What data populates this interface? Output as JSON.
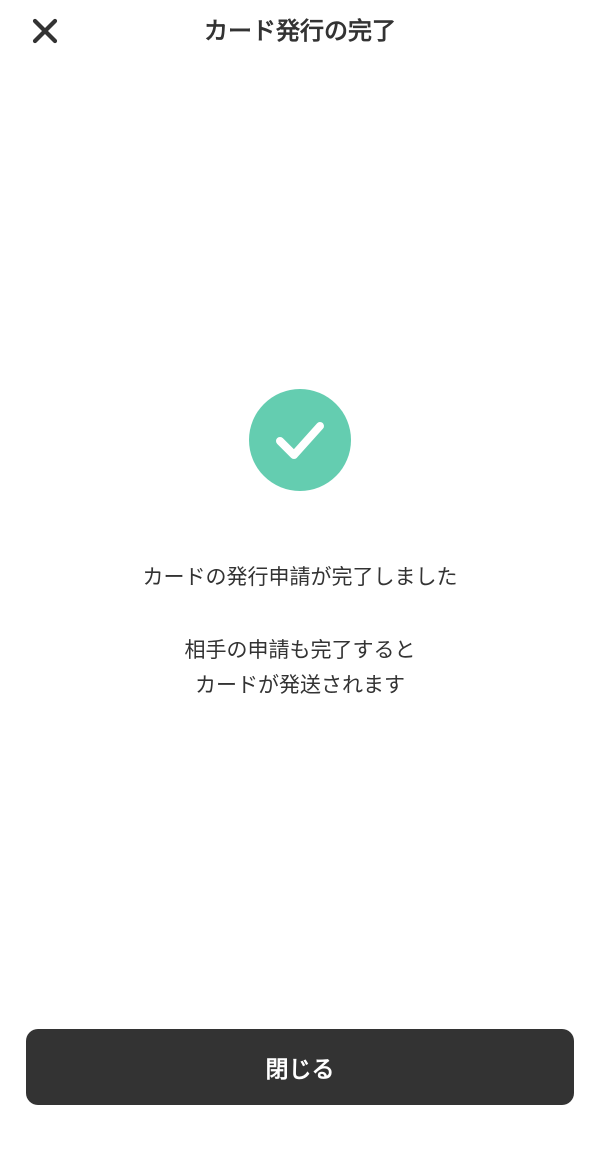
{
  "header": {
    "title": "カード発行の完了",
    "close_icon": "close-icon"
  },
  "status": {
    "icon": "check-icon",
    "message": "カードの発行申請が完了しました",
    "sub_lines": [
      "相手の申請も完了すると",
      "カードが発送されます"
    ]
  },
  "footer": {
    "close_label": "閉じる"
  },
  "colors": {
    "accent": "#64cdb0",
    "button_bg": "#333333",
    "text": "#333333"
  }
}
